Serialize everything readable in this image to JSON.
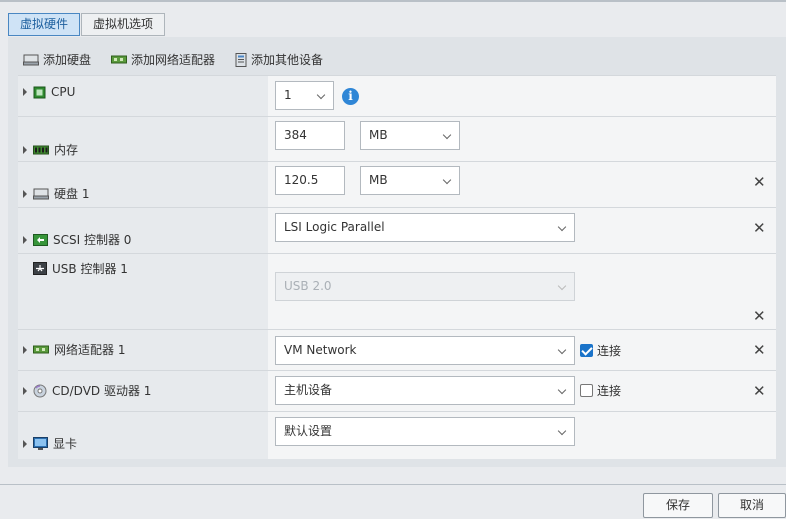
{
  "tabs": [
    {
      "label": "虚拟硬件",
      "active": true
    },
    {
      "label": "虚拟机选项",
      "active": false
    }
  ],
  "toolbar": {
    "add_disk": "添加硬盘",
    "add_nic": "添加网络适配器",
    "add_other": "添加其他设备"
  },
  "rows": {
    "cpu": {
      "label": "CPU",
      "value": "1",
      "icon": "cpu-chip-icon"
    },
    "memory": {
      "label": "内存",
      "value": "384",
      "unit": "MB",
      "icon": "memory-module-icon"
    },
    "disk": {
      "label": "硬盘 1",
      "value": "120.5",
      "unit": "MB",
      "icon": "hard-disk-icon"
    },
    "scsi": {
      "label": "SCSI 控制器 0",
      "value": "LSI Logic Parallel",
      "icon": "scsi-controller-icon"
    },
    "usb": {
      "label": "USB 控制器 1",
      "value": "USB 2.0",
      "icon": "usb-icon"
    },
    "nic": {
      "label": "网络适配器 1",
      "value": "VM Network",
      "connect_label": "连接",
      "connected": true,
      "icon": "network-card-icon"
    },
    "cdrom": {
      "label": "CD/DVD 驱动器 1",
      "value": "主机设备",
      "connect_label": "连接",
      "connected": false,
      "icon": "cd-dvd-icon"
    },
    "video": {
      "label": "显卡",
      "value": "默认设置",
      "icon": "monitor-icon"
    }
  },
  "footer": {
    "save": "保存",
    "cancel": "取消"
  },
  "colors": {
    "accent": "#2f86d6",
    "tab_active_bg": "#cfe3f6"
  }
}
